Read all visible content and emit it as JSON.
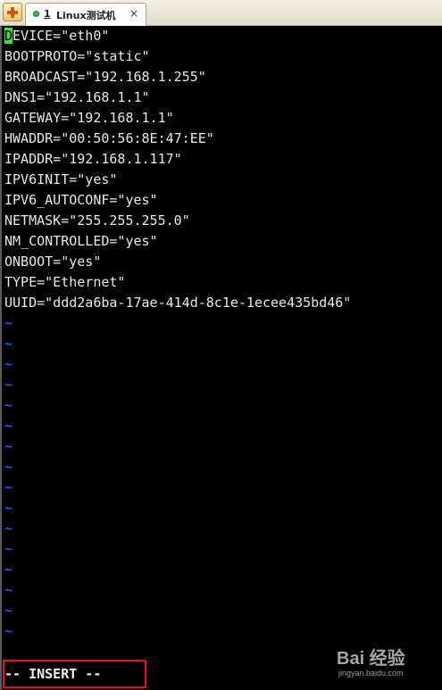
{
  "tab": {
    "number": "1",
    "title": "Linux测试机",
    "close": "×"
  },
  "editor": {
    "cursor_char": "D",
    "first_line_rest": "EVICE=\"eth0\"",
    "lines": [
      "BOOTPROTO=\"static\"",
      "BROADCAST=\"192.168.1.255\"",
      "DNS1=\"192.168.1.1\"",
      "GATEWAY=\"192.168.1.1\"",
      "HWADDR=\"00:50:56:8E:47:EE\"",
      "IPADDR=\"192.168.1.117\"",
      "IPV6INIT=\"yes\"",
      "IPV6_AUTOCONF=\"yes\"",
      "NETMASK=\"255.255.255.0\"",
      "NM_CONTROLLED=\"yes\"",
      "ONBOOT=\"yes\"",
      "TYPE=\"Ethernet\"",
      "UUID=\"ddd2a6ba-17ae-414d-8c1e-1ecee435bd46\""
    ],
    "tilde": "~",
    "tilde_count": 16,
    "mode_indicator": "-- INSERT --"
  },
  "watermark": {
    "logo": "Bai 经验",
    "sub": "jingyan.baidu.com"
  },
  "colors": {
    "cursor": "#33e833",
    "tilde": "#2a4dff",
    "highlight": "#e0131b"
  },
  "icons": {
    "new_tab": "plus-icon",
    "tab_status": "status-dot-icon",
    "close": "close-icon"
  }
}
